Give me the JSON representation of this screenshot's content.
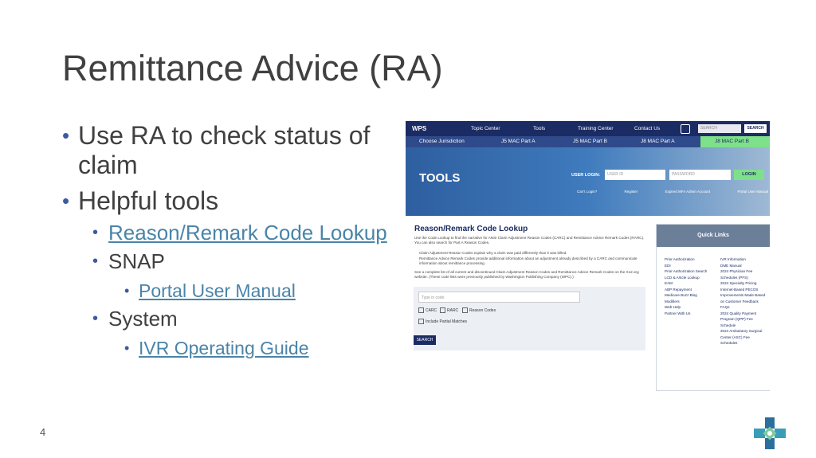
{
  "slide": {
    "title": "Remittance Advice (RA)",
    "page_number": "4",
    "bullets": {
      "check_status": "Use RA to check status of claim",
      "helpful_tools": "Helpful tools",
      "reason_remark": "Reason/Remark Code Lookup",
      "snap": "SNAP",
      "portal_manual": "Portal User Manual",
      "system": "System",
      "ivr_guide": "IVR Operating Guide"
    }
  },
  "screenshot": {
    "brand": "WPS",
    "nav": {
      "topic_center": "Topic Center",
      "tools": "Tools",
      "training_center": "Training Center",
      "contact_us": "Contact Us",
      "search_placeholder": "SEARCH",
      "search_button": "SEARCH"
    },
    "jurisdiction": {
      "choose": "Choose Jurisdiction",
      "j5a": "J5 MAC Part A",
      "j5b": "J5 MAC Part B",
      "j8a": "J8 MAC Part A",
      "j8b": "J8 MAC Part B"
    },
    "hero": {
      "heading": "TOOLS",
      "login_label": "USER LOGIN:",
      "user_id": "USER ID",
      "password": "PASSWORD",
      "login_button": "LOGIN",
      "links": [
        "Can't Login?",
        "Register",
        "Expired MFA Admin Account",
        "Portal User Manual"
      ]
    },
    "lookup": {
      "title": "Reason/Remark Code Lookup",
      "intro": "Use the Code Lookup to find the narrative for ANSI Claim Adjustment Reason Codes (CARC) and Remittance Advice Remark Codes (RARC). You can also search for Part A Reason Codes.",
      "bullet1": "Claim Adjustment Reason Codes explain why a claim was paid differently than it was billed.",
      "bullet2": "Remittance Advice Remark Codes provide additional information about an adjustment already described by a CARC and communicate information about remittance processing.",
      "note": "See a complete list of all current and discontinued Claim Adjustment Reason Codes and Remittance Advice Remark Codes on the X12.org website. (These code lists were previously published by Washington Publishing Company (WPC).)",
      "input_placeholder": "Type in code",
      "check_carc": "CARC",
      "check_rarc": "RARC",
      "check_reason": "Reason Codes",
      "check_partial": "Include Partial Matches",
      "search_button": "SEARCH"
    },
    "quick_links": {
      "title": "Quick Links",
      "col1": [
        "Prior Authorization",
        "EDI",
        "Prior Authorization Search",
        "LCD & Article Lookup",
        "EAM",
        "ABP Repayment",
        "Medicare Buzz Blog",
        "Modifiers",
        "Web Help",
        "Partner With Us"
      ],
      "col2": [
        "IVR Information",
        "DME Manual",
        "2024 Physician Fee Schedules (PFS)",
        "2024 Specialty Pricing",
        "Internet-Based PECOS",
        "Improvements Made Based on Customer Feedback",
        "FAQs",
        "2024 Quality Payment Program (QPP) Fee Schedule",
        "2024 Ambulatory Surgical Center (ASC) Fee Schedules"
      ]
    }
  },
  "colors": {
    "title": "#404040",
    "bullet": "#3b5aa0",
    "link": "#4a84a8",
    "navy": "#1b2b63",
    "green": "#7ee08a"
  }
}
